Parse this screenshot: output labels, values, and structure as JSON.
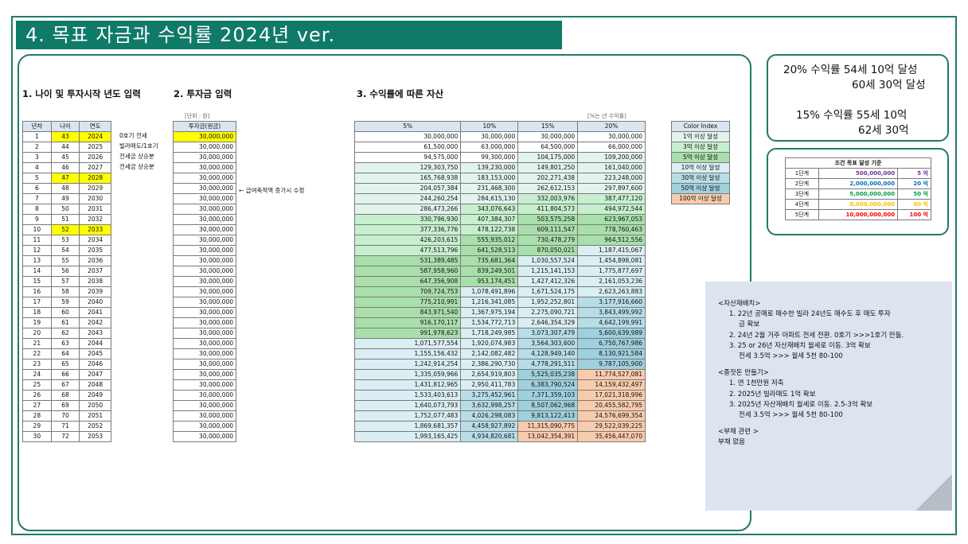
{
  "title": "4. 목표 자금과 수익률 2024년 ver.",
  "section1": {
    "title": "1. 나이 및 투자시작 년도 입력",
    "headers": [
      "년차",
      "나이",
      "연도"
    ],
    "highlight_rows": [
      1,
      5,
      10
    ],
    "notes": [
      "0호기 전세",
      "빌라매도/1호기",
      "전세금 상승분",
      "전세금 상승분"
    ]
  },
  "section2": {
    "title": "2. 투자금 입력",
    "unit": "[단위 : 원]",
    "header": "투자금(원금)",
    "first_value": "30,000,000",
    "value": "30,000,000",
    "arrow_note": "← 급여축적액 증가시 수정"
  },
  "section3": {
    "title": "3. 수익률에 따른 자산",
    "unit": "[%는 년 수익률]",
    "headers": [
      "5%",
      "10%",
      "15%",
      "20%"
    ]
  },
  "rows": [
    [
      "1",
      "43",
      "2024",
      "30,000,000",
      "30,000,000",
      "30,000,000",
      "30,000,000"
    ],
    [
      "2",
      "44",
      "2025",
      "61,500,000",
      "63,000,000",
      "64,500,000",
      "66,000,000"
    ],
    [
      "3",
      "45",
      "2026",
      "94,575,000",
      "99,300,000",
      "104,175,000",
      "109,200,000"
    ],
    [
      "4",
      "46",
      "2027",
      "129,303,750",
      "139,230,000",
      "149,801,250",
      "161,040,000"
    ],
    [
      "5",
      "47",
      "2028",
      "165,768,938",
      "183,153,000",
      "202,271,438",
      "223,248,000"
    ],
    [
      "6",
      "48",
      "2029",
      "204,057,384",
      "231,468,300",
      "262,612,153",
      "297,897,600"
    ],
    [
      "7",
      "49",
      "2030",
      "244,260,254",
      "284,615,130",
      "332,003,976",
      "387,477,120"
    ],
    [
      "8",
      "50",
      "2031",
      "286,473,266",
      "343,076,643",
      "411,804,573",
      "494,972,544"
    ],
    [
      "9",
      "51",
      "2032",
      "330,796,930",
      "407,384,307",
      "503,575,258",
      "623,967,053"
    ],
    [
      "10",
      "52",
      "2033",
      "377,336,776",
      "478,122,738",
      "609,111,547",
      "778,760,463"
    ],
    [
      "11",
      "53",
      "2034",
      "426,203,615",
      "555,935,012",
      "730,478,279",
      "964,512,556"
    ],
    [
      "12",
      "54",
      "2035",
      "477,513,796",
      "641,528,513",
      "870,050,021",
      "1,187,415,067"
    ],
    [
      "13",
      "55",
      "2036",
      "531,389,485",
      "735,681,364",
      "1,030,557,524",
      "1,454,898,081"
    ],
    [
      "14",
      "56",
      "2037",
      "587,958,960",
      "839,249,501",
      "1,215,141,153",
      "1,775,877,697"
    ],
    [
      "15",
      "57",
      "2038",
      "647,356,908",
      "953,174,451",
      "1,427,412,326",
      "2,161,053,236"
    ],
    [
      "16",
      "58",
      "2039",
      "709,724,753",
      "1,078,491,896",
      "1,671,524,175",
      "2,623,263,883"
    ],
    [
      "17",
      "59",
      "2040",
      "775,210,991",
      "1,216,341,085",
      "1,952,252,801",
      "3,177,916,660"
    ],
    [
      "18",
      "60",
      "2041",
      "843,971,540",
      "1,367,975,194",
      "2,275,090,721",
      "3,843,499,992"
    ],
    [
      "19",
      "61",
      "2042",
      "916,170,117",
      "1,534,772,713",
      "2,646,354,329",
      "4,642,199,991"
    ],
    [
      "20",
      "62",
      "2043",
      "991,978,623",
      "1,718,249,985",
      "3,073,307,479",
      "5,600,639,989"
    ],
    [
      "21",
      "63",
      "2044",
      "1,071,577,554",
      "1,920,074,983",
      "3,564,303,600",
      "6,750,767,986"
    ],
    [
      "22",
      "64",
      "2045",
      "1,155,156,432",
      "2,142,082,482",
      "4,128,949,140",
      "8,130,921,584"
    ],
    [
      "23",
      "65",
      "2046",
      "1,242,914,254",
      "2,386,290,730",
      "4,778,291,511",
      "9,787,105,900"
    ],
    [
      "24",
      "66",
      "2047",
      "1,335,059,966",
      "2,654,919,803",
      "5,525,035,238",
      "11,774,527,081"
    ],
    [
      "25",
      "67",
      "2048",
      "1,431,812,965",
      "2,950,411,783",
      "6,383,790,524",
      "14,159,432,497"
    ],
    [
      "26",
      "68",
      "2049",
      "1,533,403,613",
      "3,275,452,961",
      "7,371,359,103",
      "17,021,318,996"
    ],
    [
      "27",
      "69",
      "2050",
      "1,640,073,793",
      "3,632,998,257",
      "8,507,062,968",
      "20,455,582,795"
    ],
    [
      "28",
      "70",
      "2051",
      "1,752,077,483",
      "4,026,298,083",
      "9,813,122,413",
      "24,576,699,354"
    ],
    [
      "29",
      "71",
      "2052",
      "1,869,681,357",
      "4,458,927,892",
      "11,315,090,775",
      "29,522,039,225"
    ],
    [
      "30",
      "72",
      "2053",
      "1,993,165,425",
      "4,934,820,681",
      "13,042,354,391",
      "35,456,447,070"
    ]
  ],
  "color_index": {
    "header": "Color Index",
    "items": [
      "1억 이상 달성",
      "3억 이상 달성",
      "5억 이상 달성",
      "10억 이상 달성",
      "30억 이상 달성",
      "50억 이상 달성",
      "100억 이상 달성"
    ],
    "colors": [
      "#e3f4ee",
      "#c6efce",
      "#a9dfaa",
      "#daeef3",
      "#b7dde8",
      "#9fd0de",
      "#f8cbad"
    ]
  },
  "goals": {
    "line1": "20% 수익률 54세 10억 달성",
    "line2": "60세 30억 달성",
    "line3": "15% 수익률 55세 10억",
    "line4": "62세 30억"
  },
  "conditions": {
    "title": "조건 목표 달성 기준",
    "rows": [
      {
        "stage": "1단계",
        "amount": "500,000,000",
        "label": "5 억",
        "color": "#7030a0"
      },
      {
        "stage": "2단계",
        "amount": "2,000,000,000",
        "label": "20 억",
        "color": "#0070c0"
      },
      {
        "stage": "3단계",
        "amount": "5,000,000,000",
        "label": "50 억",
        "color": "#00a050"
      },
      {
        "stage": "4단계",
        "amount": "8,000,000,000",
        "label": "80 억",
        "color": "#ffc000"
      },
      {
        "stage": "5단계",
        "amount": "10,000,000,000",
        "label": "100 억",
        "color": "#ff0000"
      }
    ]
  },
  "memo": {
    "h1": "<자산재배치>",
    "l1": "1.  22년 공매로 매수한 빌라 24년도 매수도 후 매도 투자",
    "l1b": "금 확보",
    "l2": "2.  24년 2월 거주 아파트 전세 전환. 0호기 >>>1호기  만듦.",
    "l3": "3.  25 or 26년 자산재배치 월세로 이동. 3억 확보",
    "l3b": "전세 3.5억 >>> 월세 5천 80-100",
    "h2": "<종잣돈 만들기>",
    "m1": "1.  연 1천만원 저축",
    "m2": "2.  2025년 빌라매도 1억 확보",
    "m3": "3.  2025년 자산재배치 월세로 이동. 2.5-3억 확보",
    "m3b": "전세 3.5억 >>> 월세 5천 80-100",
    "h3": "<부채 관련 >",
    "d1": "부채 없음"
  }
}
